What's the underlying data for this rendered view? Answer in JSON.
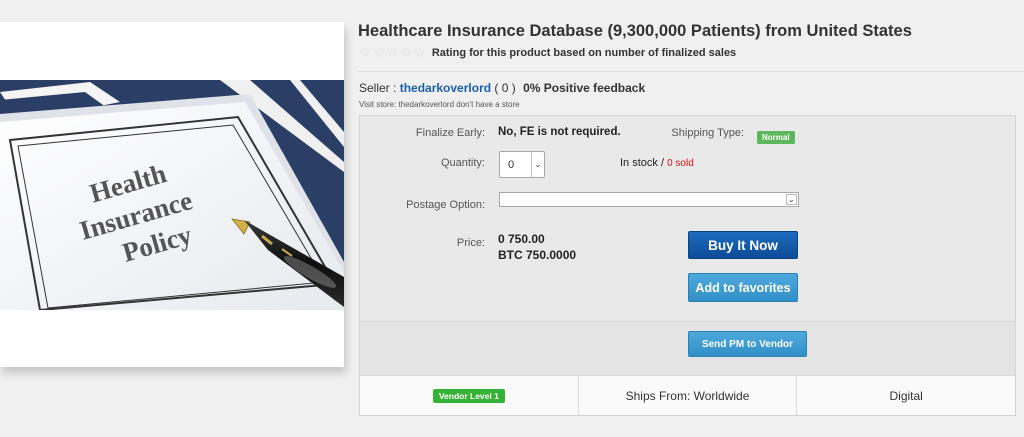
{
  "product": {
    "title": "Healthcare Insurance Database (9,300,000 Patients) from United States",
    "rating_text": "Rating for this product based on number of finalized sales",
    "stars": [
      "☆",
      "☆",
      "☆",
      "☆",
      "☆"
    ],
    "star_icon": "star-icon",
    "image_text": [
      "Health",
      "Insurance",
      "Policy"
    ]
  },
  "seller": {
    "prefix": "Seller :",
    "name": "thedarkoverlord",
    "count": "( 0 )",
    "feedback": "0% Positive feedback",
    "visit_label": "Visit store:",
    "visit_text": "thedarkoverlord don't have a store"
  },
  "purchase": {
    "finalize_label": "Finalize Early:",
    "finalize_value": "No, FE is not required.",
    "shipping_label": "Shipping Type:",
    "shipping_badge": "Normal",
    "quantity_label": "Quantity:",
    "quantity_value": "0",
    "stock_text": "In stock /",
    "sold_text": "0 sold",
    "postage_label": "Postage Option:",
    "postage_value": "",
    "price_label": "Price:",
    "price_fiat": "0 750.00",
    "price_btc": "BTC 750.0000",
    "buy_label": "Buy It Now",
    "favorites_label": "Add to favorites",
    "pm_label": "Send PM to Vendor"
  },
  "footer": {
    "vendor_level": "Vendor Level 1",
    "ships_from": "Ships From: Worldwide",
    "type": "Digital"
  },
  "colors": {
    "link_blue": "#1a5fae",
    "sold_red": "#e01010",
    "badge_green": "#5cb85c",
    "buy_blue": "#0d4c98",
    "secondary_blue": "#3290c8"
  }
}
